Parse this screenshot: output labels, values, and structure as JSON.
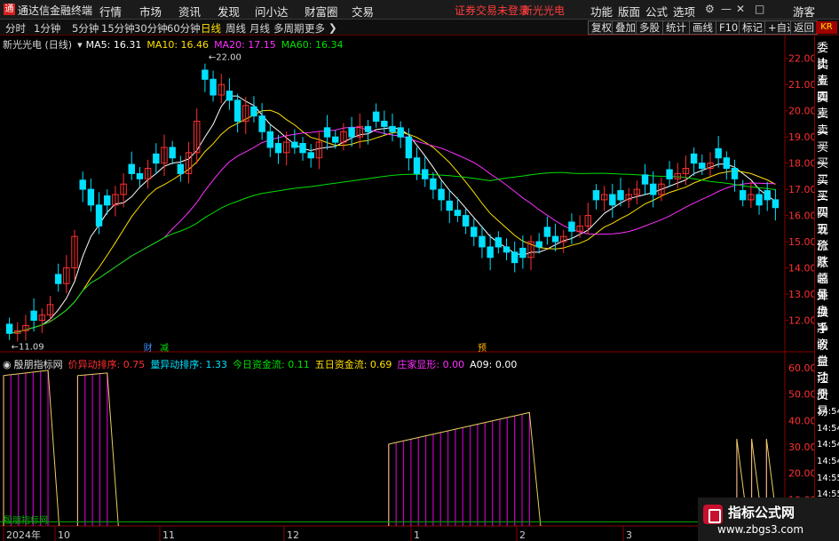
{
  "menubar": {
    "logo_glyph": "通",
    "app_title": "通达信金融终端",
    "menus": [
      "行情",
      "市场",
      "资讯",
      "发现",
      "问小达",
      "财富圈",
      "交易"
    ],
    "login_warning": "证券交易未登录",
    "stock_name": "新光光电",
    "right_menus": [
      "功能",
      "版面",
      "公式",
      "选项"
    ],
    "guest": "游客"
  },
  "periodbar": {
    "periods": [
      "分时",
      "1分钟",
      "5分钟",
      "15分钟",
      "30分钟",
      "60分钟",
      "日线",
      "周线",
      "月线",
      "多周期",
      "更多"
    ],
    "active_period": "日线",
    "tools": [
      "复权",
      "叠加",
      "多股",
      "统计",
      "画线",
      "F10",
      "标记",
      "+自选",
      "返回"
    ]
  },
  "main_chart": {
    "title": "新光光电 (日线)",
    "ma": [
      {
        "label": "MA5: 16.31",
        "color": "#ffffff"
      },
      {
        "label": "MA10: 16.46",
        "color": "#ffe000"
      },
      {
        "label": "MA20: 17.15",
        "color": "#ff30ff"
      },
      {
        "label": "MA60: 16.34",
        "color": "#00e000"
      }
    ],
    "high_label": "22.00",
    "low_label": "11.09",
    "price_axis": [
      "22.00",
      "21.00",
      "20.00",
      "19.00",
      "18.00",
      "17.00",
      "16.00",
      "15.00",
      "14.00",
      "13.00",
      "12.00"
    ],
    "event_badges": [
      "财",
      "减",
      "预"
    ]
  },
  "indicator": {
    "name": "殷朋指标网",
    "values": [
      {
        "label": "价异动排序: 0.75",
        "color": "#ff3030"
      },
      {
        "label": "量异动排序: 1.33",
        "color": "#00e0ff"
      },
      {
        "label": "今日资金流: 0.11",
        "color": "#00e000"
      },
      {
        "label": "五日资金流: 0.69",
        "color": "#ffe000"
      },
      {
        "label": "庄家显形: 0.00",
        "color": "#ff30ff"
      },
      {
        "label": "A09: 0.00",
        "color": "#ffffff"
      }
    ],
    "axis": [
      "60.00",
      "50.00",
      "40.00",
      "30.00",
      "20.00",
      "10.00"
    ],
    "overlay_text": "殷朋指标网"
  },
  "date_axis": [
    "2024年",
    "10",
    "11",
    "12",
    "1",
    "2",
    "3"
  ],
  "sidepanel": {
    "kr_badge": "KR",
    "items": [
      "委比",
      "卖五",
      "卖四",
      "卖三",
      "卖二",
      "卖一",
      "买一",
      "买二",
      "买三",
      "买四",
      "买五",
      "现价",
      "涨跌",
      "涨幅",
      "总量",
      "外盘",
      "换手",
      "净资",
      "收益",
      "自动",
      "注册",
      "交易",
      "14:54",
      "14:54",
      "14:54",
      "14:54",
      "14:55",
      "14:55",
      "14:55"
    ]
  },
  "watermark": {
    "title": "指标公式网",
    "url": "www.zbgs3.com"
  },
  "chart_data": [
    {
      "type": "candlestick",
      "title": "新光光电 (日线)",
      "ylim": [
        11,
        22.6
      ],
      "closes": [
        11.5,
        11.6,
        11.8,
        12.0,
        12.2,
        12.6,
        13.4,
        14.0,
        15.2,
        17.0,
        16.4,
        15.6,
        16.4,
        16.8,
        17.2,
        17.6,
        17.4,
        17.8,
        18.0,
        18.6,
        18.2,
        17.6,
        18.4,
        19.6,
        21.2,
        20.6,
        21.0,
        20.4,
        19.6,
        20.2,
        19.8,
        19.2,
        18.6,
        18.4,
        18.8,
        18.6,
        18.4,
        18.2,
        18.8,
        19.0,
        18.8,
        19.2,
        19.0,
        19.4,
        19.2,
        19.6,
        19.4,
        19.2,
        19.0,
        18.2,
        17.6,
        17.4,
        17.0,
        16.6,
        16.2,
        16.0,
        15.6,
        15.2,
        14.8,
        14.4,
        14.8,
        14.6,
        14.2,
        14.4,
        15.0,
        14.8,
        15.2,
        15.0,
        15.2,
        15.4,
        15.6,
        16.0,
        16.6,
        16.8,
        16.4,
        16.6,
        16.8,
        17.0,
        17.2,
        16.8,
        17.2,
        17.4,
        17.6,
        17.8,
        18.0,
        17.8,
        18.0,
        18.2,
        17.8,
        17.4,
        16.6,
        16.8,
        16.4,
        16.6,
        16.3
      ]
    },
    {
      "type": "bar",
      "title": "殷朋指标网",
      "ylim": [
        0,
        62
      ],
      "segments": [
        {
          "start_index": 0,
          "end_index": 6,
          "from": 57,
          "to": 59
        },
        {
          "start_index": 10,
          "end_index": 14,
          "from": 57,
          "to": 58
        },
        {
          "start_index": 52,
          "end_index": 71,
          "from": 31,
          "to": 43
        },
        {
          "start_index": 99,
          "end_index": 99,
          "from": 33,
          "to": 33
        },
        {
          "start_index": 101,
          "end_index": 101,
          "from": 33,
          "to": 33
        },
        {
          "start_index": 103,
          "end_index": 103,
          "from": 33,
          "to": 33
        }
      ]
    }
  ]
}
